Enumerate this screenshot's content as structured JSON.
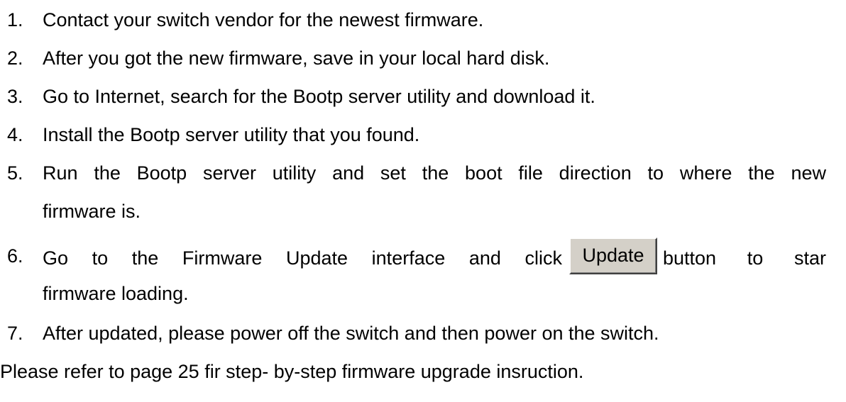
{
  "steps": [
    {
      "num": "1.",
      "text": "Contact your switch vendor for the newest firmware."
    },
    {
      "num": "2.",
      "text": "After you got the new firmware, save in your local hard disk."
    },
    {
      "num": "3.",
      "text": "Go to Internet, search for the Bootp server utility and download it."
    },
    {
      "num": "4.",
      "text": "Install the Bootp server utility that you found."
    },
    {
      "num": "5.",
      "text_line1": "Run the Bootp server utility and set the boot file direction to where the new",
      "text_line2": "firmware is."
    },
    {
      "num": "6.",
      "text_before": "Go to the Firmware Update interface and click",
      "button_label": "Update",
      "text_after": "button to star",
      "text_line2": "firmware loading."
    },
    {
      "num": "7.",
      "text": "After updated, please power off the switch and then power on the switch."
    }
  ],
  "footer": "Please refer to page 25 fir step- by-step firmware upgrade insruction."
}
